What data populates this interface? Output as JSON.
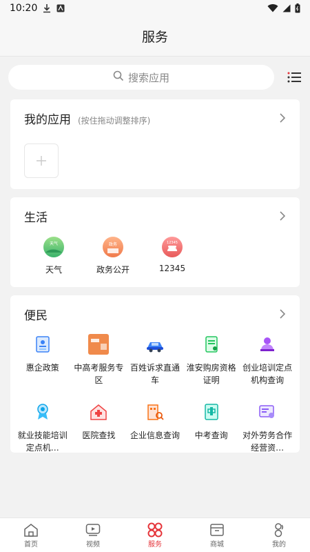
{
  "status_bar": {
    "time": "10:20"
  },
  "header": {
    "title": "服务"
  },
  "search": {
    "placeholder": "搜索应用"
  },
  "my_apps": {
    "title": "我的应用",
    "hint": "(按住拖动调整排序)"
  },
  "life": {
    "title": "生活",
    "items": [
      {
        "label": "天气",
        "icon": "weather-icon",
        "badge": "天气"
      },
      {
        "label": "政务公开",
        "icon": "gov-open-icon",
        "badge": "政务"
      },
      {
        "label": "12345",
        "icon": "hotline-icon",
        "badge": "12345"
      }
    ]
  },
  "convenience": {
    "title": "便民",
    "items": [
      {
        "label": "惠企政策",
        "icon": "policy-icon"
      },
      {
        "label": "中高考服务专区",
        "icon": "exam-service-icon"
      },
      {
        "label": "百姓诉求直通车",
        "icon": "citizen-appeal-icon"
      },
      {
        "label": "淮安购房资格证明",
        "icon": "housing-cert-icon"
      },
      {
        "label": "创业培训定点机构查询",
        "icon": "startup-training-icon"
      },
      {
        "label": "就业技能培训定点机…",
        "icon": "skill-training-icon"
      },
      {
        "label": "医院查找",
        "icon": "hospital-icon"
      },
      {
        "label": "企业信息查询",
        "icon": "company-info-icon"
      },
      {
        "label": "中考查询",
        "icon": "exam-query-icon"
      },
      {
        "label": "对外劳务合作经营资…",
        "icon": "labor-coop-icon"
      }
    ]
  },
  "tabbar": {
    "items": [
      {
        "label": "首页",
        "icon": "home-icon"
      },
      {
        "label": "视频",
        "icon": "video-icon"
      },
      {
        "label": "服务",
        "icon": "service-icon",
        "active": true
      },
      {
        "label": "商城",
        "icon": "mall-icon"
      },
      {
        "label": "我的",
        "icon": "profile-icon"
      }
    ]
  },
  "colors": {
    "accent": "#e5343a",
    "background": "#f2f2f2",
    "card": "#ffffff"
  }
}
